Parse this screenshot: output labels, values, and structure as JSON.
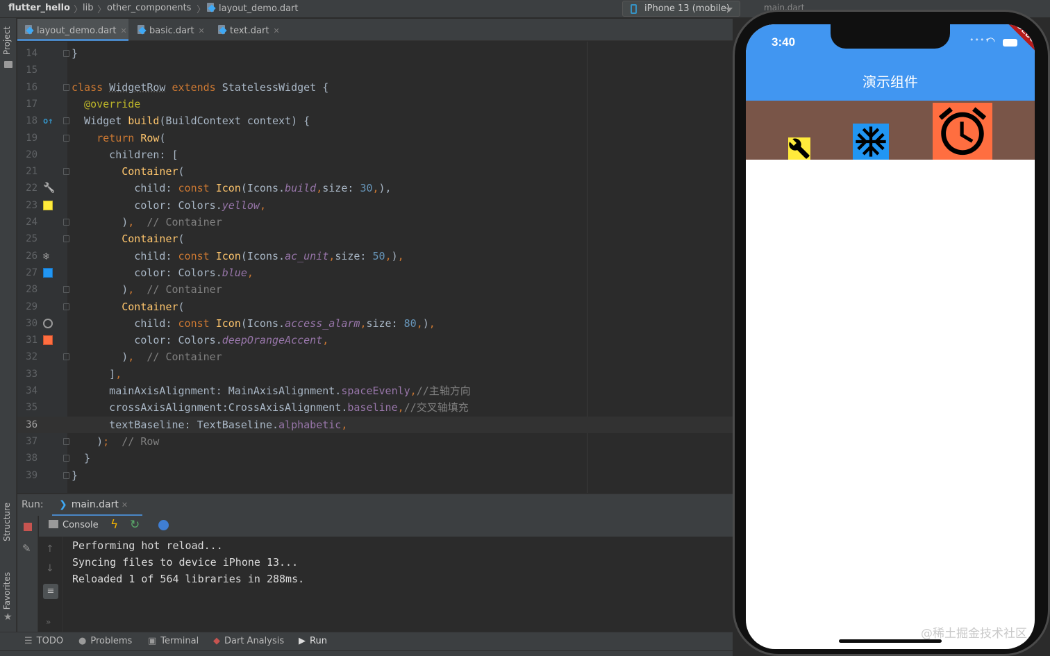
{
  "breadcrumb": {
    "project": "flutter_hello",
    "folder1": "lib",
    "folder2": "other_components",
    "file": "layout_demo.dart"
  },
  "device_selector": {
    "label": "iPhone 13 (mobile)"
  },
  "run_config": {
    "label": "main.dart"
  },
  "left_strip": {
    "project": "Project",
    "structure": "Structure",
    "favorites": "Favorites"
  },
  "tabs": [
    {
      "label": "layout_demo.dart",
      "active": true
    },
    {
      "label": "basic.dart",
      "active": false
    },
    {
      "label": "text.dart",
      "active": false
    }
  ],
  "code": {
    "current_line": "36",
    "lines": [
      {
        "n": "14",
        "parts": [
          [
            "",
            "}"
          ]
        ]
      },
      {
        "n": "15",
        "parts": []
      },
      {
        "n": "16",
        "parts": [
          [
            "kw",
            "class "
          ],
          [
            "u",
            "WidgetRow"
          ],
          [
            "kw",
            " extends "
          ],
          [
            "",
            "StatelessWidget {"
          ]
        ]
      },
      {
        "n": "17",
        "parts": [
          [
            "ann",
            "  @override"
          ]
        ]
      },
      {
        "n": "18",
        "parts": [
          [
            "",
            "  Widget "
          ],
          [
            "fn",
            "build"
          ],
          [
            "",
            "(BuildContext context) {"
          ]
        ]
      },
      {
        "n": "19",
        "parts": [
          [
            "kw",
            "    return "
          ],
          [
            "fn",
            "Row"
          ],
          [
            "",
            "("
          ]
        ]
      },
      {
        "n": "20",
        "parts": [
          [
            "",
            "      children: ["
          ]
        ]
      },
      {
        "n": "21",
        "parts": [
          [
            "fn",
            "        Container"
          ],
          [
            "",
            "("
          ]
        ]
      },
      {
        "n": "22",
        "parts": [
          [
            "",
            "          child: "
          ],
          [
            "kw",
            "const "
          ],
          [
            "fn",
            "Icon"
          ],
          [
            "",
            "(Icons."
          ],
          [
            "fld",
            "build"
          ],
          [
            "kw",
            ","
          ],
          [
            "",
            "size: "
          ],
          [
            "num",
            "30"
          ],
          [
            "kw",
            ","
          ],
          [
            "",
            "),"
          ]
        ]
      },
      {
        "n": "23",
        "parts": [
          [
            "",
            "          color: Colors."
          ],
          [
            "fld",
            "yellow"
          ],
          [
            "kw",
            ","
          ]
        ]
      },
      {
        "n": "24",
        "parts": [
          [
            "",
            "        )"
          ],
          [
            "kw",
            ","
          ],
          [
            "cm",
            "  // Container"
          ]
        ]
      },
      {
        "n": "25",
        "parts": [
          [
            "fn",
            "        Container"
          ],
          [
            "",
            "("
          ]
        ]
      },
      {
        "n": "26",
        "parts": [
          [
            "",
            "          child: "
          ],
          [
            "kw",
            "const "
          ],
          [
            "fn",
            "Icon"
          ],
          [
            "",
            "(Icons."
          ],
          [
            "fld",
            "ac_unit"
          ],
          [
            "kw",
            ","
          ],
          [
            "",
            "size: "
          ],
          [
            "num",
            "50"
          ],
          [
            "kw",
            ","
          ],
          [
            "",
            ")"
          ],
          [
            "kw",
            ","
          ]
        ]
      },
      {
        "n": "27",
        "parts": [
          [
            "",
            "          color: Colors."
          ],
          [
            "fld",
            "blue"
          ],
          [
            "kw",
            ","
          ]
        ]
      },
      {
        "n": "28",
        "parts": [
          [
            "",
            "        )"
          ],
          [
            "kw",
            ","
          ],
          [
            "cm",
            "  // Container"
          ]
        ]
      },
      {
        "n": "29",
        "parts": [
          [
            "fn",
            "        Container"
          ],
          [
            "",
            "("
          ]
        ]
      },
      {
        "n": "30",
        "parts": [
          [
            "",
            "          child: "
          ],
          [
            "kw",
            "const "
          ],
          [
            "fn",
            "Icon"
          ],
          [
            "",
            "(Icons."
          ],
          [
            "fld",
            "access_alarm"
          ],
          [
            "kw",
            ","
          ],
          [
            "",
            "size: "
          ],
          [
            "num",
            "80"
          ],
          [
            "kw",
            ","
          ],
          [
            "",
            ")"
          ],
          [
            "kw",
            ","
          ]
        ]
      },
      {
        "n": "31",
        "parts": [
          [
            "",
            "          color: Colors."
          ],
          [
            "fld",
            "deepOrangeAccent"
          ],
          [
            "kw",
            ","
          ]
        ]
      },
      {
        "n": "32",
        "parts": [
          [
            "",
            "        )"
          ],
          [
            "kw",
            ","
          ],
          [
            "cm",
            "  // Container"
          ]
        ]
      },
      {
        "n": "33",
        "parts": [
          [
            "",
            "      ]"
          ],
          [
            "kw",
            ","
          ]
        ]
      },
      {
        "n": "34",
        "parts": [
          [
            "",
            "      mainAxisAlignment: MainAxisAlignment."
          ],
          [
            "fld2",
            "spaceEvenly"
          ],
          [
            "kw",
            ","
          ],
          [
            "cm",
            "//主轴方向"
          ]
        ]
      },
      {
        "n": "35",
        "parts": [
          [
            "",
            "      crossAxisAlignment:CrossAxisAlignment."
          ],
          [
            "fld2",
            "baseline"
          ],
          [
            "kw",
            ","
          ],
          [
            "cm",
            "//交叉轴填充"
          ]
        ]
      },
      {
        "n": "36",
        "parts": [
          [
            "",
            "      textBaseline: TextBaseline."
          ],
          [
            "fld2",
            "alphabetic"
          ],
          [
            "kw",
            ","
          ]
        ]
      },
      {
        "n": "37",
        "parts": [
          [
            "",
            "    )"
          ],
          [
            "kw",
            ";"
          ],
          [
            "cm",
            "  // Row"
          ]
        ]
      },
      {
        "n": "38",
        "parts": [
          [
            "",
            "  }"
          ]
        ]
      },
      {
        "n": "39",
        "parts": [
          [
            "",
            "}"
          ]
        ]
      }
    ]
  },
  "run_panel": {
    "label": "Run:",
    "tab": "main.dart",
    "console_label": "Console",
    "output": [
      "Performing hot reload...",
      "Syncing files to device iPhone 13...",
      "Reloaded 1 of 564 libraries in 288ms."
    ]
  },
  "bottom_tabs": [
    {
      "label": "TODO",
      "icon": "list-icon"
    },
    {
      "label": "Problems",
      "icon": "problems-icon"
    },
    {
      "label": "Terminal",
      "icon": "terminal-icon"
    },
    {
      "label": "Dart Analysis",
      "icon": "dart-analysis-icon"
    },
    {
      "label": "Run",
      "icon": "run-icon"
    }
  ],
  "simulator": {
    "time": "3:40",
    "debug_banner": "DEBUG",
    "app_title": "演示组件",
    "colors": {
      "appbar": "#4196f1",
      "row": "#795548",
      "yellow": "#ffeb3b",
      "blue": "#2196f3",
      "deepOrangeAccent": "#ff6e40"
    },
    "icons": [
      "build-icon",
      "ac-unit-icon",
      "access-alarm-icon"
    ]
  },
  "watermark": "@稀土掘金技术社区"
}
